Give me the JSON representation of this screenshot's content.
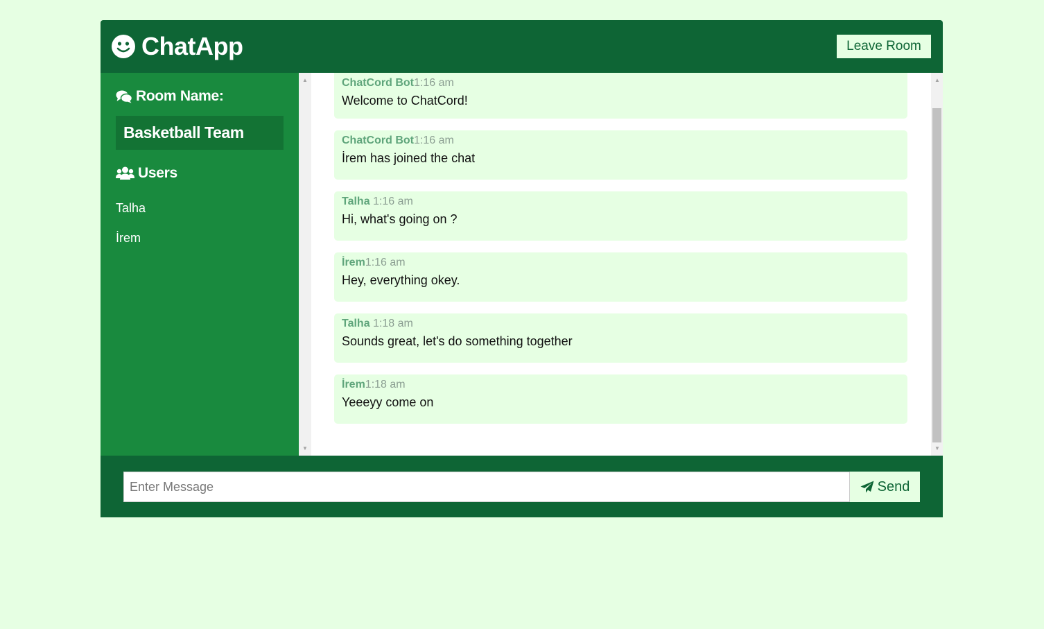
{
  "header": {
    "title": "ChatApp",
    "leave_label": "Leave Room"
  },
  "sidebar": {
    "room_heading": "Room Name:",
    "room_name": "Basketball Team",
    "users_heading": "Users",
    "users": [
      "Talha",
      "İrem"
    ]
  },
  "messages": [
    {
      "user": "ChatCord Bot",
      "time": "1:16 am",
      "text": "Welcome to ChatCord!"
    },
    {
      "user": "ChatCord Bot",
      "time": "1:16 am",
      "text": "İrem has joined the chat"
    },
    {
      "user": "Talha ",
      "time": "1:16 am",
      "text": "Hi, what's going on ?"
    },
    {
      "user": "İrem",
      "time": "1:16 am",
      "text": "Hey, everything okey."
    },
    {
      "user": "Talha ",
      "time": "1:18 am",
      "text": "Sounds great, let's do something together"
    },
    {
      "user": "İrem",
      "time": "1:18 am",
      "text": "Yeeeyy come on"
    }
  ],
  "composer": {
    "placeholder": "Enter Message",
    "send_label": "Send"
  },
  "colors": {
    "page_bg": "#e6ffe3",
    "header_bg": "#0e6535",
    "sidebar_bg": "#198a3e",
    "room_bg": "#137334"
  },
  "icons": {
    "brand": "smile-icon",
    "room": "comments-icon",
    "users": "users-icon",
    "send": "paper-plane-icon"
  }
}
